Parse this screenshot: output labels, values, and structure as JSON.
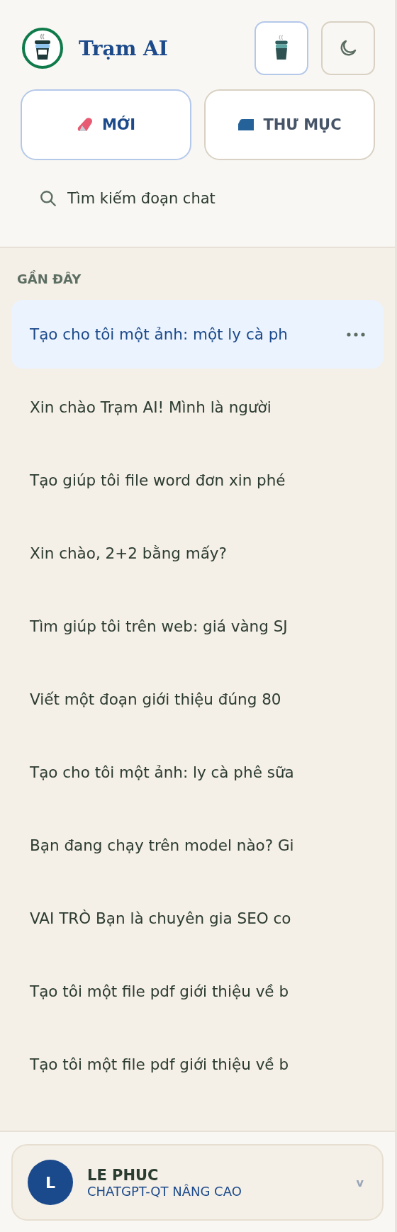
{
  "brand": {
    "name": "Trạm AI"
  },
  "actions": [
    {
      "kind": "new",
      "label": "MỚI"
    },
    {
      "kind": "folder",
      "label": "THƯ MỤC"
    }
  ],
  "search": {
    "placeholder": "Tìm kiếm đoạn chat"
  },
  "recent": {
    "heading": "GẦN ĐÂY",
    "items": [
      {
        "title": "Tạo cho tôi một ảnh: một ly cà ph",
        "selected": true
      },
      {
        "title": "Xin chào Trạm AI! Mình là người",
        "selected": false
      },
      {
        "title": "Tạo giúp tôi file word đơn xin phé",
        "selected": false
      },
      {
        "title": "Xin chào, 2+2 bằng mấy?",
        "selected": false
      },
      {
        "title": "Tìm giúp tôi trên web: giá vàng SJ",
        "selected": false
      },
      {
        "title": "Viết một đoạn giới thiệu đúng 80",
        "selected": false
      },
      {
        "title": "Tạo cho tôi một ảnh: ly cà phê sữa",
        "selected": false
      },
      {
        "title": "Bạn đang chạy trên model nào? Gi",
        "selected": false
      },
      {
        "title": "VAI TRÒ Bạn là chuyên gia SEO co",
        "selected": false
      },
      {
        "title": "Tạo tôi một file pdf giới thiệu về b",
        "selected": false
      },
      {
        "title": "Tạo tôi một file pdf giới thiệu về b",
        "selected": false
      }
    ]
  },
  "user": {
    "initial": "L",
    "name": "LE PHUC",
    "plan": "CHATGPT-QT NÂNG CAO",
    "chevron": "v"
  }
}
